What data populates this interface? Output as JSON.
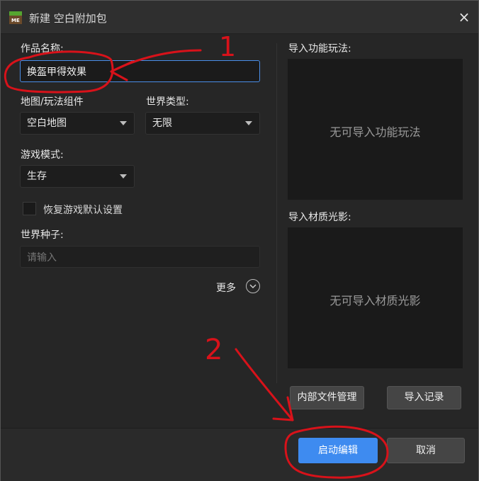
{
  "window": {
    "title": "新建 空白附加包",
    "close_symbol": "×"
  },
  "form": {
    "name_label": "作品名称:",
    "name_value": "换盔甲得效果",
    "map_label": "地图/玩法组件",
    "map_value": "空白地图",
    "world_type_label": "世界类型:",
    "world_type_value": "无限",
    "game_mode_label": "游戏模式:",
    "game_mode_value": "生存",
    "restore_defaults_label": "恢复游戏默认设置",
    "restore_defaults_checked": false,
    "seed_label": "世界种子:",
    "seed_placeholder": "请输入",
    "more_label": "更多"
  },
  "right": {
    "function_label": "导入功能玩法:",
    "function_empty": "无可导入功能玩法",
    "texture_label": "导入材质光影:",
    "texture_empty": "无可导入材质光影"
  },
  "buttons": {
    "internal_files": "内部文件管理",
    "import_records": "导入记录",
    "start_edit": "启动编辑",
    "cancel": "取消"
  },
  "annotations": {
    "mark_1": "1",
    "mark_2": "2",
    "ink_color": "#d8121a"
  }
}
